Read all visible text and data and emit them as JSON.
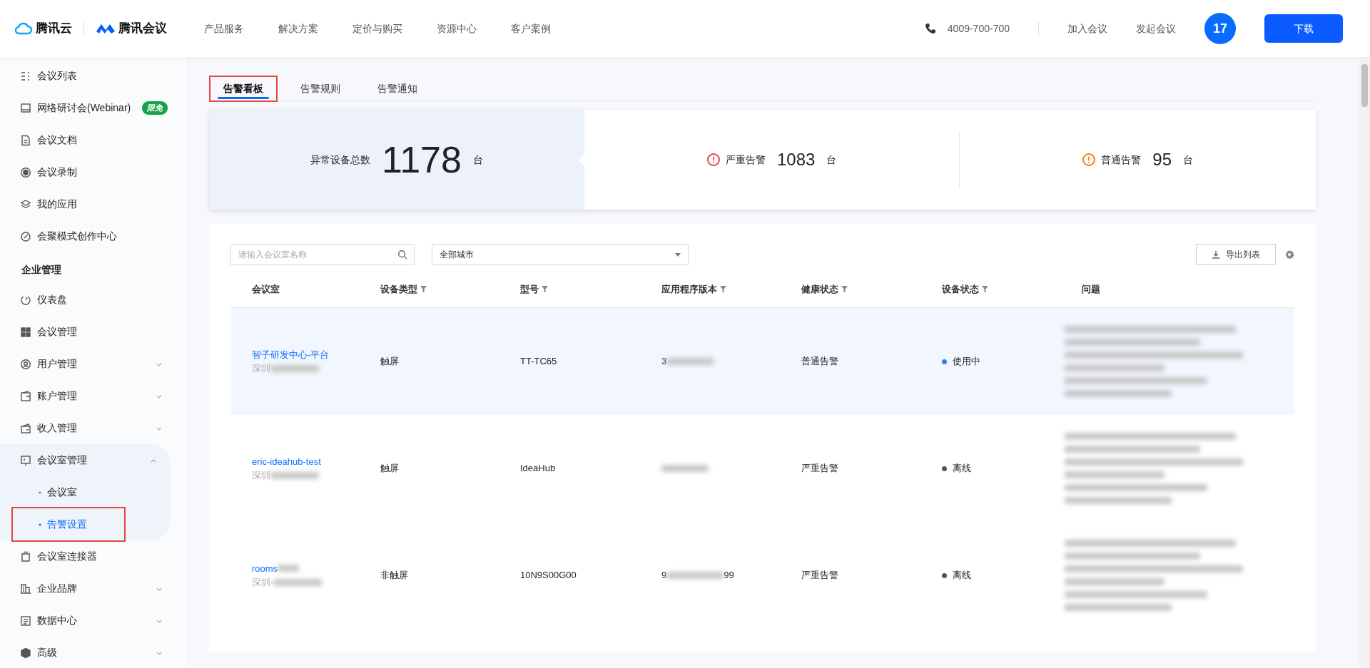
{
  "header": {
    "brand_cloud": "腾讯云",
    "brand_meeting": "腾讯会议",
    "nav": [
      "产品服务",
      "解决方案",
      "定价与购买",
      "资源中心",
      "客户案例"
    ],
    "phone": "4009-700-700",
    "links": [
      "加入会议",
      "发起会议"
    ],
    "avatar": "17",
    "download": "下载"
  },
  "sidebar": {
    "items": [
      {
        "kind": "item",
        "label": "会议列表"
      },
      {
        "kind": "item",
        "label": "网络研讨会(Webinar)",
        "badge": "限免"
      },
      {
        "kind": "item",
        "label": "会议文档"
      },
      {
        "kind": "item",
        "label": "会议录制"
      },
      {
        "kind": "item",
        "label": "我的应用"
      },
      {
        "kind": "item",
        "label": "会聚模式创作中心"
      },
      {
        "kind": "section",
        "label": "企业管理"
      },
      {
        "kind": "item",
        "label": "仪表盘"
      },
      {
        "kind": "item",
        "label": "会议管理"
      },
      {
        "kind": "item",
        "label": "用户管理",
        "expanded": false
      },
      {
        "kind": "item",
        "label": "账户管理",
        "expanded": false
      },
      {
        "kind": "item",
        "label": "收入管理",
        "expanded": false
      },
      {
        "kind": "item",
        "label": "会议室管理",
        "expanded": true,
        "children": [
          {
            "label": "会议室",
            "selected": false,
            "highlighted": false
          },
          {
            "label": "告警设置",
            "selected": true,
            "highlighted": true
          }
        ]
      },
      {
        "kind": "item",
        "label": "会议室连接器"
      },
      {
        "kind": "item",
        "label": "企业品牌",
        "expanded": false
      },
      {
        "kind": "item",
        "label": "数据中心",
        "expanded": false
      },
      {
        "kind": "item",
        "label": "高级",
        "expanded": false
      }
    ]
  },
  "tabs": [
    {
      "label": "告警看板",
      "selected": true,
      "highlighted": true
    },
    {
      "label": "告警规则",
      "selected": false,
      "highlighted": false
    },
    {
      "label": "告警通知",
      "selected": false,
      "highlighted": false
    }
  ],
  "summary": {
    "total": {
      "label": "异常设备总数",
      "value": "1178",
      "unit": "台"
    },
    "levels": [
      {
        "label": "严重告警",
        "value": "1083",
        "unit": "台",
        "color": "#e54545"
      },
      {
        "label": "普通告警",
        "value": "95",
        "unit": "台",
        "color": "#ff7a00"
      }
    ]
  },
  "toolbar": {
    "search": {
      "placeholder": "请输入会议室名称"
    },
    "city": "全部城市",
    "export": "导出列表"
  },
  "table": {
    "columns": [
      {
        "label": "会议室",
        "filter": false
      },
      {
        "label": "设备类型",
        "filter": true
      },
      {
        "label": "型号",
        "filter": true
      },
      {
        "label": "应用程序版本",
        "filter": true
      },
      {
        "label": "健康状态",
        "filter": true
      },
      {
        "label": "设备状态",
        "filter": true
      },
      {
        "label": "问题",
        "filter": false
      }
    ],
    "rows": [
      {
        "selected": true,
        "room": "智子研发中心-平台",
        "location": "深圳",
        "type": "触屏",
        "model": "TT-TC65",
        "version_start": "3",
        "health": "普通告警",
        "status": {
          "label": "使用中",
          "color": "#2d7ff9"
        }
      },
      {
        "selected": false,
        "room": "eric-ideahub-test",
        "location": "深圳",
        "type": "触屏",
        "model": "IdeaHub",
        "health": "严重告警",
        "status": {
          "label": "离线",
          "color": "#555555"
        }
      },
      {
        "selected": false,
        "room": "rooms",
        "location": "深圳-",
        "type": "非触屏",
        "model": "10N9S00G00",
        "version_start": "9",
        "version_end": "99",
        "health": "严重告警",
        "status": {
          "label": "离线",
          "color": "#555555"
        }
      }
    ]
  }
}
